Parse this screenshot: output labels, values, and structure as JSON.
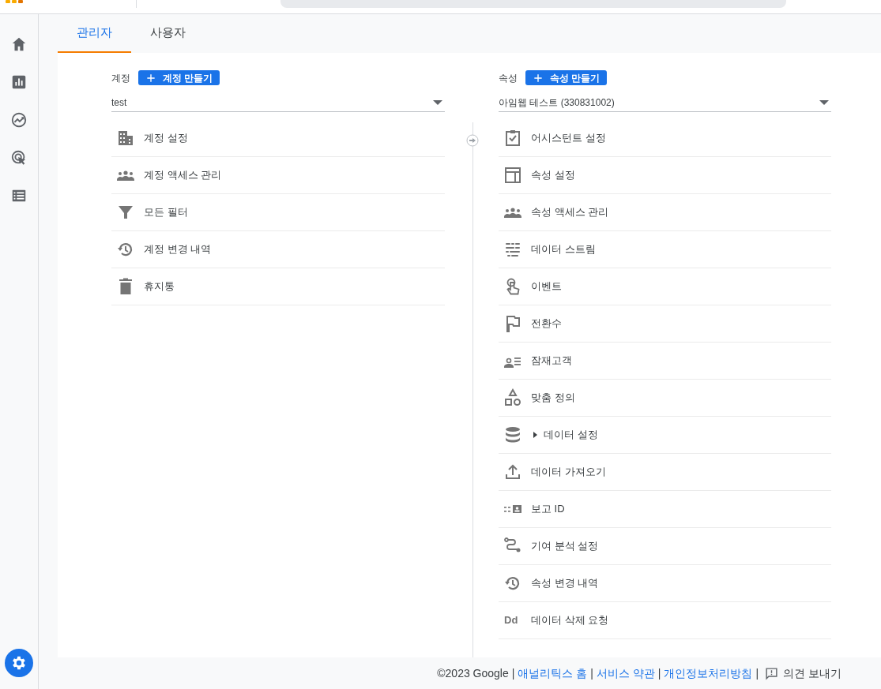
{
  "tabs": [
    {
      "label": "관리자",
      "selected": true
    },
    {
      "label": "사용자",
      "selected": false
    }
  ],
  "account": {
    "label": "계정",
    "create_button": "계정 만들기",
    "dropdown_value": "test",
    "items": [
      {
        "label": "계정 설정"
      },
      {
        "label": "계정 액세스 관리"
      },
      {
        "label": "모든 필터"
      },
      {
        "label": "계정 변경 내역"
      },
      {
        "label": "휴지통"
      }
    ]
  },
  "property": {
    "label": "속성",
    "create_button": "속성 만들기",
    "dropdown_value": "아임웹 테스트 (330831002)",
    "items": [
      {
        "label": "어시스턴트 설정"
      },
      {
        "label": "속성 설정"
      },
      {
        "label": "속성 액세스 관리"
      },
      {
        "label": "데이터 스트림"
      },
      {
        "label": "이벤트"
      },
      {
        "label": "전환수"
      },
      {
        "label": "잠재고객"
      },
      {
        "label": "맞춤 정의"
      },
      {
        "label": "데이터 설정",
        "expanded": false
      },
      {
        "label": "데이터 가져오기"
      },
      {
        "label": "보고 ID"
      },
      {
        "label": "기여 분석 설정"
      },
      {
        "label": "속성 변경 내역"
      },
      {
        "label": "데이터 삭제 요청",
        "icon_text": "Dd"
      }
    ]
  },
  "footer": [
    {
      "kind": "text",
      "text": "©2023 Google"
    },
    {
      "kind": "separator",
      "text": "|"
    },
    {
      "kind": "link",
      "text": "애널리틱스 홈"
    },
    {
      "kind": "separator",
      "text": "|"
    },
    {
      "kind": "link",
      "text": "서비스 약관"
    },
    {
      "kind": "separator",
      "text": "|"
    },
    {
      "kind": "link",
      "text": "개인정보처리방침"
    },
    {
      "kind": "separator",
      "text": "|"
    },
    {
      "kind": "feedback",
      "text": "의견 보내기"
    }
  ]
}
